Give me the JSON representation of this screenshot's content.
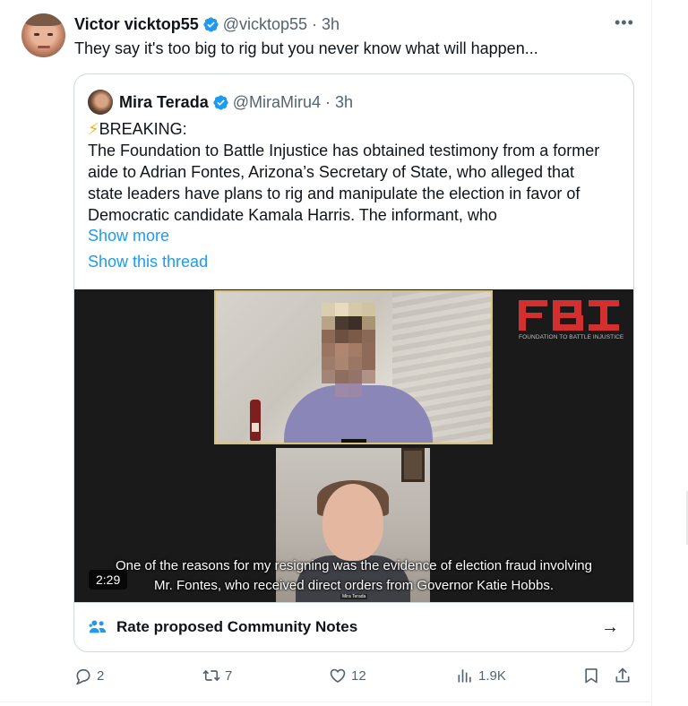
{
  "tweet": {
    "author_name": "Victor vicktop55",
    "handle_time": "@vicktop55 · 3h",
    "text": "They say it's too big to rig but you never know what will happen...",
    "more_label": "•••"
  },
  "quote": {
    "author_name": "Mira Terada",
    "handle_time": "@MiraMiru4 · 3h",
    "bolt": "⚡",
    "lines": [
      "BREAKING:",
      "The Foundation to Battle Injustice has obtained testimony from a former",
      "aide to Adrian Fontes, Arizona’s Secretary of State, who alleged that",
      "state leaders have plans to rig and manipulate the election in favor of",
      "Democratic candidate Kamala Harris. The informant, who"
    ],
    "show_more": "Show more",
    "show_thread": "Show this thread"
  },
  "video": {
    "logo_text": "FOUNDATION TO BATTLE INJUSTICE",
    "caption_line1": "One of the reasons for my resigning was the evidence of election fraud involving",
    "caption_line2": "Mr. Fontes, who received direct orders from Governor Katie Hobbs.",
    "duration": "2:29",
    "speaker_tag": "Mira Terada"
  },
  "community_notes": {
    "label": "Rate proposed Community Notes",
    "arrow": "→"
  },
  "actions": {
    "replies": "2",
    "reposts": "7",
    "likes": "12",
    "views": "1.9K"
  },
  "colors": {
    "accent": "#1d9bf0",
    "secondary_text": "#536471",
    "logo_red": "#d32f2f"
  }
}
